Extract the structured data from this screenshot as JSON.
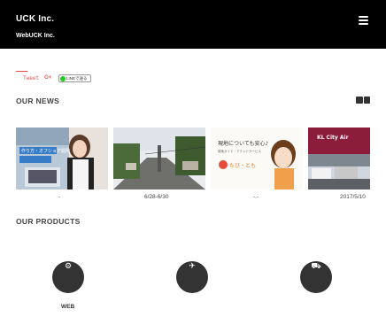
{
  "header": {
    "brand": "UCK Inc.",
    "tagline": "WebUCK Inc.",
    "menu_icon": "hamburger-menu-icon"
  },
  "share": {
    "tweet_label": "Tweet",
    "gplus_label": "G+",
    "line_label": "LINEで送る"
  },
  "news": {
    "title": "OUR NEWS",
    "view_icon": "grid-view-icon",
    "items": [
      {
        "image": "woman-laptop-photo",
        "date": "-",
        "overlay": "作り方・オフショア開発"
      },
      {
        "image": "street-scene-photo",
        "date": "6/28-6/30",
        "overlay": ""
      },
      {
        "image": "tabitomo-banner",
        "date": "-.-",
        "overlay": "現地についても安心♪",
        "overlay2": "現地ガイド・アテンドサービス",
        "brand": "たび・とも"
      },
      {
        "image": "kl-city-air-photo",
        "date": "2017/5/10",
        "overlay": "KL City Air"
      }
    ]
  },
  "products": {
    "title": "OUR PRODUCTS",
    "items": [
      {
        "icon": "gear-icon",
        "label": "WEB"
      },
      {
        "icon": "airplane-icon",
        "label": ""
      },
      {
        "icon": "car-icon",
        "label": ""
      }
    ]
  },
  "colors": {
    "header_bg": "#000000",
    "accent_red": "#dd5555",
    "product_circle": "#333333"
  }
}
